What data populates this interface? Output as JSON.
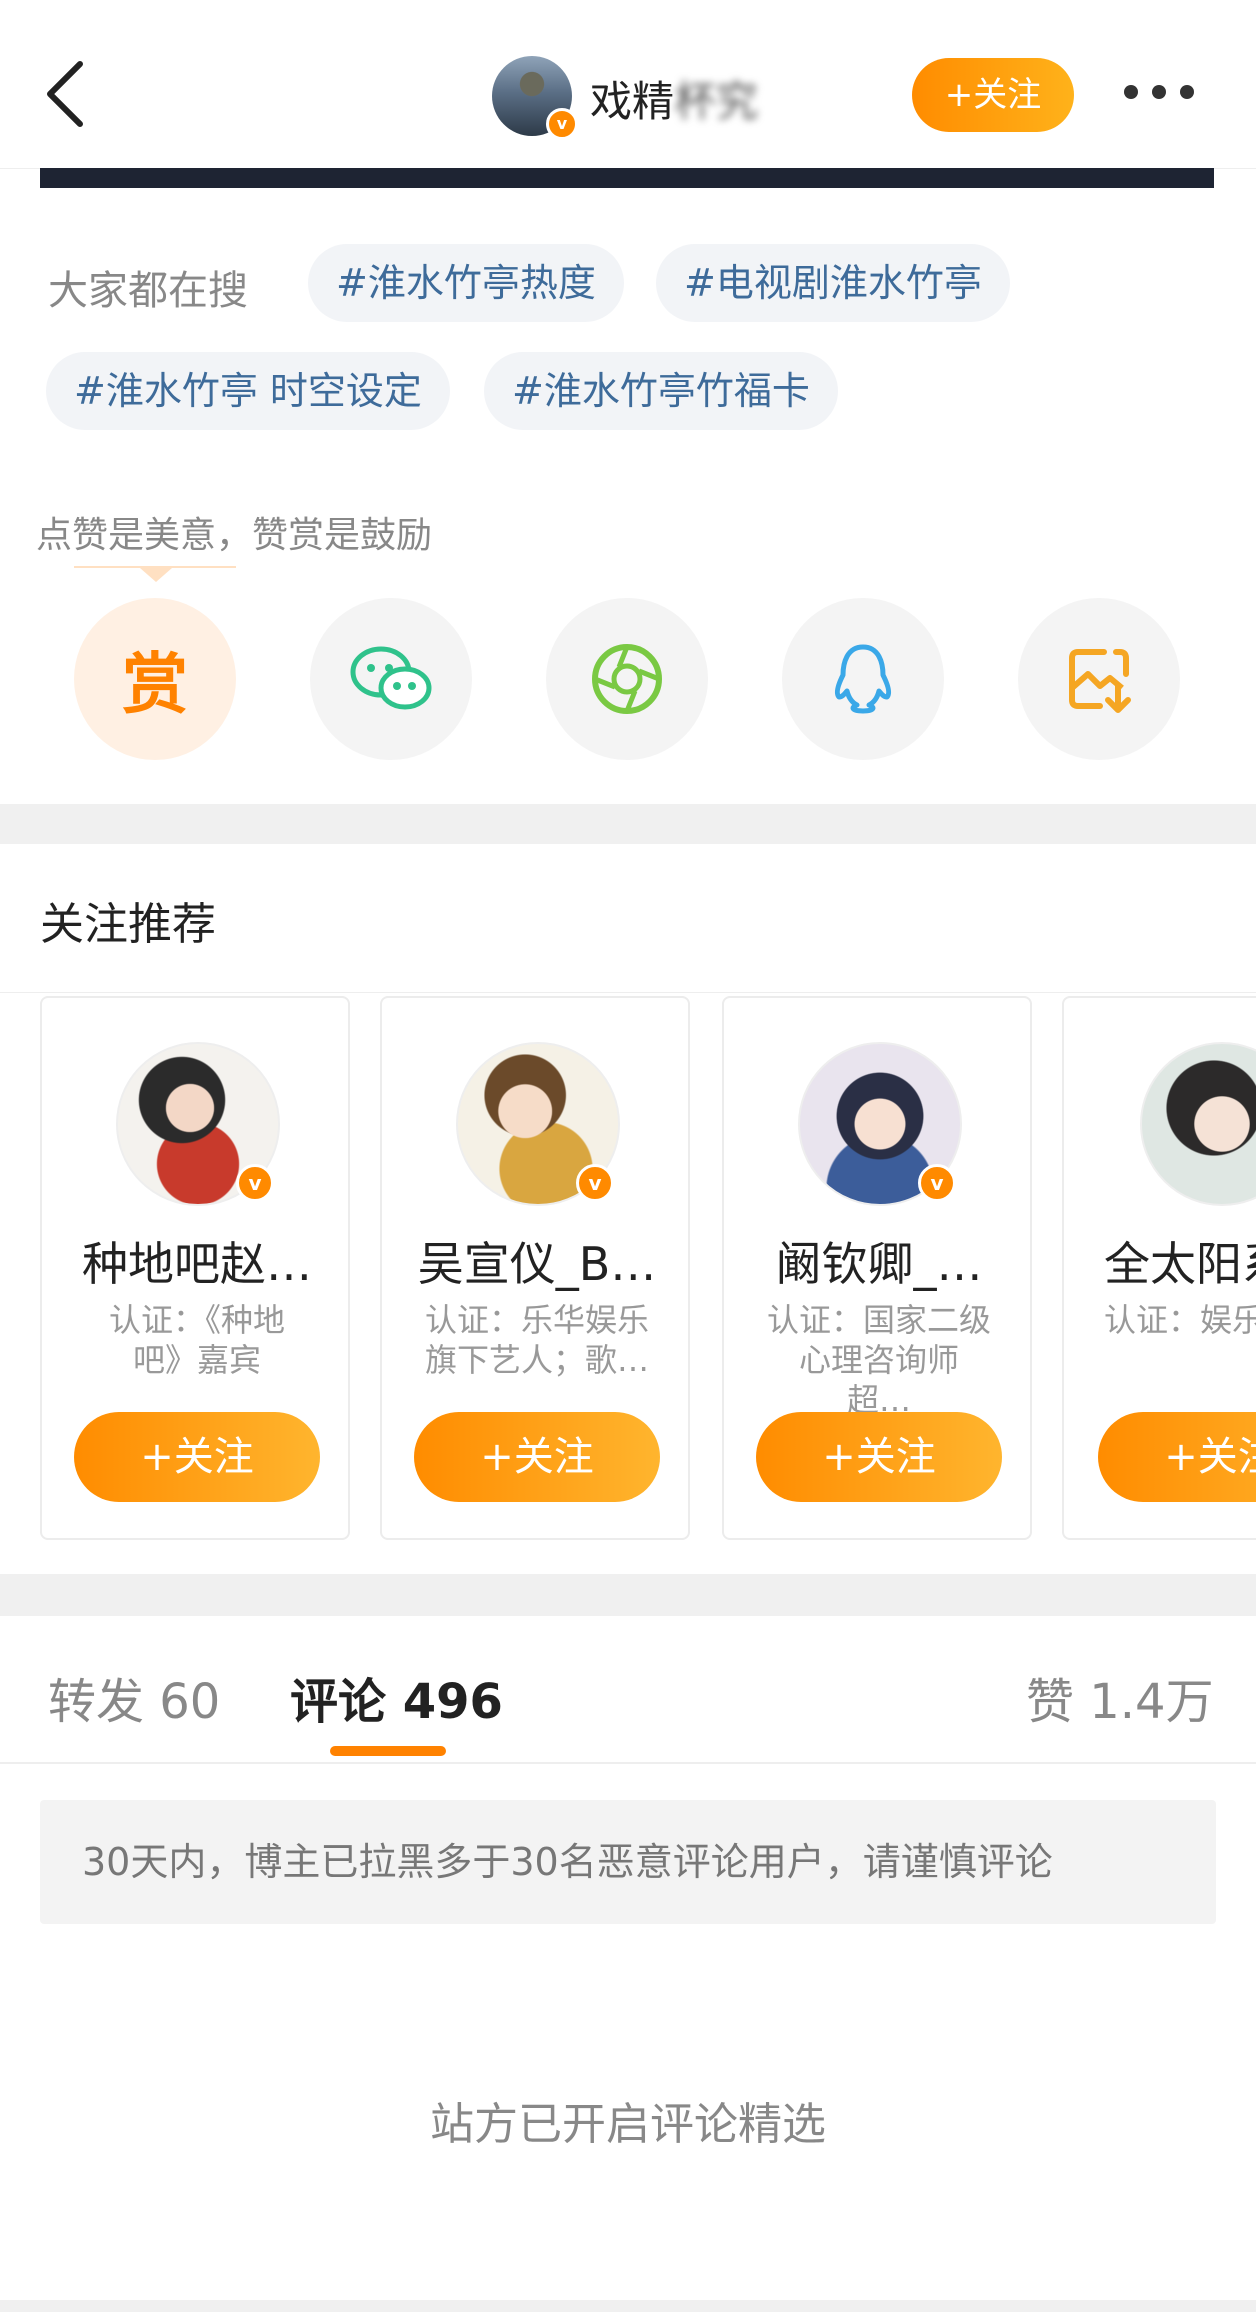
{
  "header": {
    "title_visible": "戏精",
    "title_obscured": "杯究",
    "follow_label": "+关注",
    "back_icon": "chevron-left-icon",
    "more_icon": "more-dots-icon"
  },
  "trending": {
    "label": "大家都在搜",
    "tags": [
      "#淮水竹亭热度",
      "#电视剧淮水竹亭",
      "#淮水竹亭 时空设定",
      "#淮水竹亭竹福卡"
    ]
  },
  "share": {
    "prompt": "点赞是美意，赞赏是鼓励",
    "reward_label": "赏",
    "icons": [
      "reward-icon",
      "wechat-icon",
      "moments-icon",
      "qq-icon",
      "save-image-icon"
    ]
  },
  "recommend": {
    "title": "关注推荐",
    "follow_label": "+关注",
    "cards": [
      {
        "name": "种地吧赵…",
        "desc_line1": "认证：《种地",
        "desc_line2": "吧》嘉宾"
      },
      {
        "name": "吴宣仪_B…",
        "desc_line1": "认证：乐华娱乐",
        "desc_line2": "旗下艺人；歌…"
      },
      {
        "name": "阚钦卿_…",
        "desc_line1": "认证：国家二级",
        "desc_line2": "心理咨询师 超…"
      },
      {
        "name": "全太阳系",
        "desc_line1": "认证：娱乐",
        "desc_line2": ""
      }
    ]
  },
  "tabs": {
    "repost": "转发 60",
    "comment": "评论 496",
    "like": "赞 1.4万"
  },
  "notice": "30天内，博主已拉黑多于30名恶意评论用户，请谨慎评论",
  "selected_notice": "站方已开启评论精选",
  "colors": {
    "accent": "#ff8200",
    "tag_text": "#3e6b9a",
    "wechat": "#2fc28b",
    "moments": "#7ac943",
    "qq": "#3aa8e8",
    "save": "#f5a623"
  }
}
